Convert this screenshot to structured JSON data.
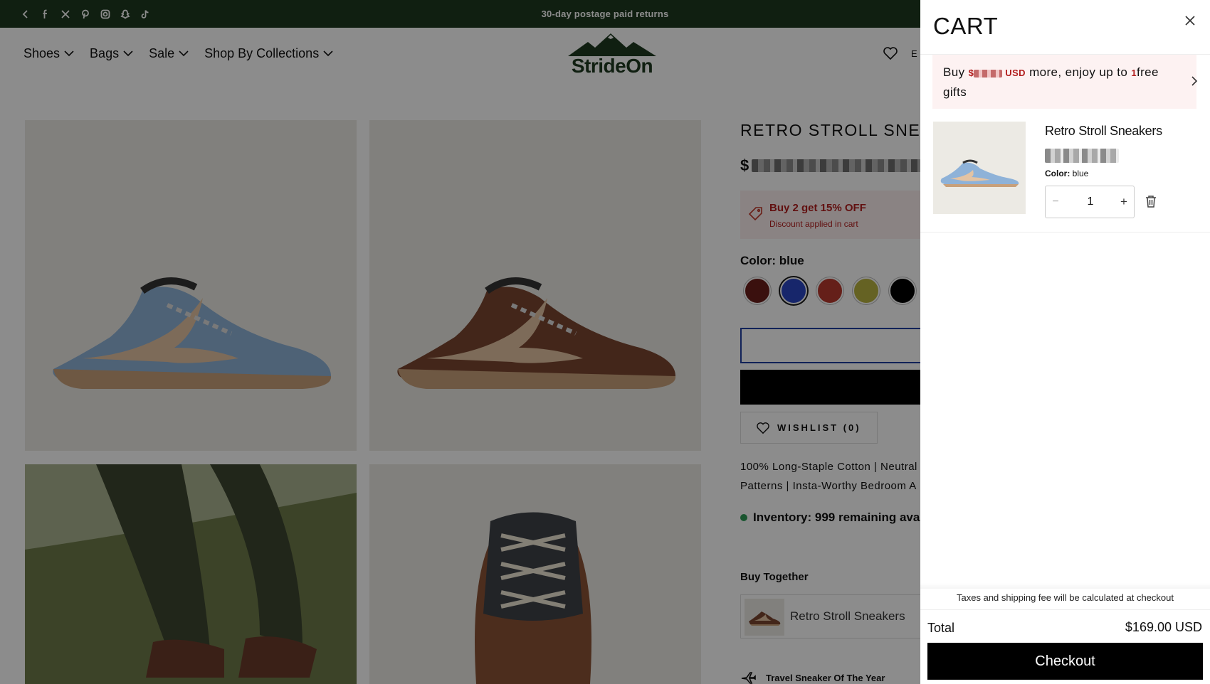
{
  "topbar": {
    "promo": "30-day postage paid returns",
    "icons": [
      "chevron-left-icon",
      "facebook-icon",
      "x-icon",
      "pinterest-icon",
      "instagram-icon",
      "snapchat-icon",
      "tiktok-icon"
    ],
    "bg_color": "#1e3a20"
  },
  "nav": {
    "items": [
      {
        "label": "Shoes"
      },
      {
        "label": "Bags"
      },
      {
        "label": "Sale"
      },
      {
        "label": "Shop By Collections"
      }
    ]
  },
  "logo": {
    "text": "StrideOn",
    "color": "#1e3a20"
  },
  "header_right": {
    "partial": "E"
  },
  "product": {
    "title": "RETRO STROLL SNEAKERS",
    "price_prefix": "$",
    "promo_title": "Buy 2 get 15% OFF",
    "promo_sub": "Discount applied in cart",
    "color_label": "Color: blue",
    "swatches": [
      {
        "name": "brown",
        "hex": "#6a1e1a"
      },
      {
        "name": "blue",
        "hex": "#2a46c4",
        "selected": true
      },
      {
        "name": "red",
        "hex": "#b83a2e"
      },
      {
        "name": "yellow",
        "hex": "#b9b241"
      },
      {
        "name": "black",
        "hex": "#000000"
      }
    ],
    "wishlist": "WISHLIST (0)",
    "description_line1": "100% Long-Staple Cotton | Neutral",
    "description_line2": "Patterns | Insta-Worthy Bedroom A",
    "inventory": "Inventory: 999 remaining ava",
    "buy_together": "Buy Together",
    "bundle_item": "Retro Stroll Sneakers",
    "badge": "Travel Sneaker Of The Year"
  },
  "cart": {
    "title": "CART",
    "gift_buy": "Buy",
    "gift_currency_prefix": "$",
    "gift_currency": "USD",
    "gift_mid": "more, enjoy up to",
    "gift_count": "1",
    "gift_end": "free gifts",
    "item_name": "Retro Stroll Sneakers",
    "item_color_label": "Color:",
    "item_color_value": "blue",
    "qty_minus": "−",
    "qty_value": "1",
    "qty_plus": "+",
    "taxes_note": "Taxes and shipping fee will be calculated at checkout",
    "total_label": "Total",
    "total_value": "$169.00 USD",
    "checkout": "Checkout"
  }
}
